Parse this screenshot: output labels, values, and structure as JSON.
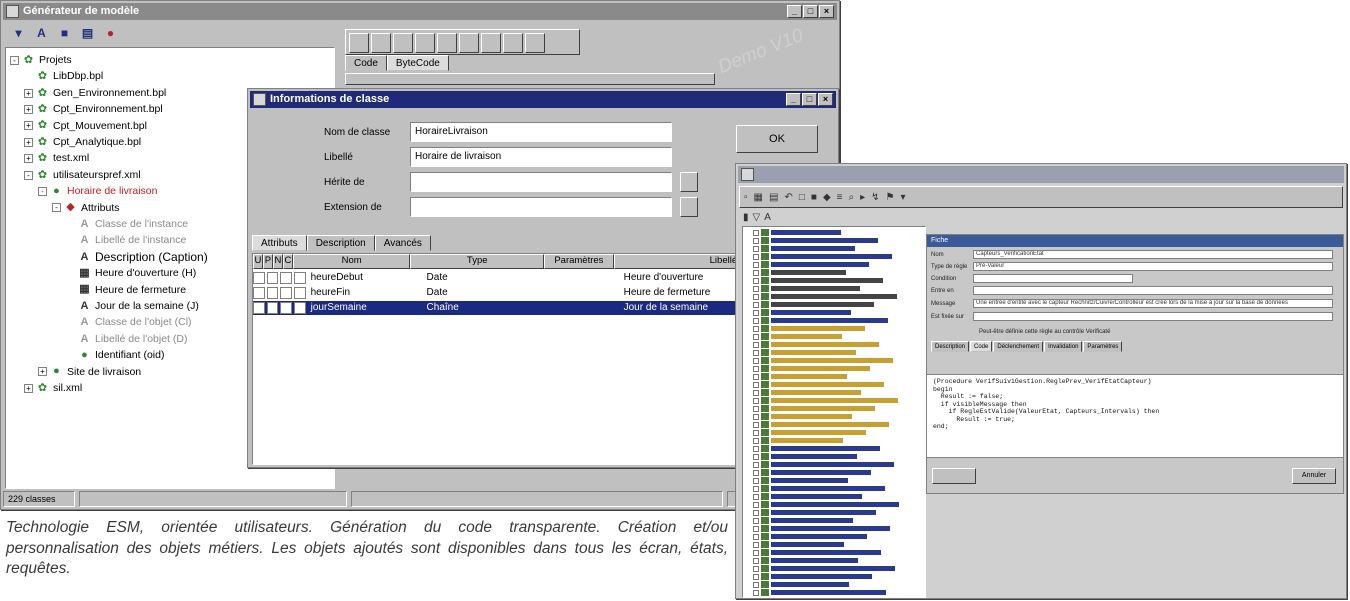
{
  "main_window": {
    "title": "Générateur de modèle",
    "status_left": "229 classes",
    "watermark": "Demo V10"
  },
  "tree": {
    "items": [
      {
        "label": "Projets",
        "depth": 0,
        "expander": "-",
        "icon": "project-icon",
        "style": ""
      },
      {
        "label": "LibDbp.bpl",
        "depth": 1,
        "expander": "",
        "icon": "package-icon",
        "style": ""
      },
      {
        "label": "Gen_Environnement.bpl",
        "depth": 1,
        "expander": "+",
        "icon": "package-icon",
        "style": ""
      },
      {
        "label": "Cpt_Environnement.bpl",
        "depth": 1,
        "expander": "+",
        "icon": "package-icon",
        "style": ""
      },
      {
        "label": "Cpt_Mouvement.bpl",
        "depth": 1,
        "expander": "+",
        "icon": "package-icon",
        "style": ""
      },
      {
        "label": "Cpt_Analytique.bpl",
        "depth": 1,
        "expander": "+",
        "icon": "package-icon",
        "style": ""
      },
      {
        "label": "test.xml",
        "depth": 1,
        "expander": "+",
        "icon": "package-icon",
        "style": ""
      },
      {
        "label": "utilisateurspref.xml",
        "depth": 1,
        "expander": "-",
        "icon": "package-icon",
        "style": ""
      },
      {
        "label": "Horaire de livraison",
        "depth": 2,
        "expander": "-",
        "icon": "class-icon",
        "style": "red"
      },
      {
        "label": "Attributs",
        "depth": 3,
        "expander": "-",
        "icon": "attributes-icon",
        "style": ""
      },
      {
        "label": "Classe de l'instance",
        "depth": 4,
        "expander": "",
        "icon": "attr-a-icon",
        "style": "grey"
      },
      {
        "label": "Libellé de l'instance",
        "depth": 4,
        "expander": "",
        "icon": "attr-a-icon",
        "style": "grey"
      },
      {
        "label": "Description (Caption)",
        "depth": 4,
        "expander": "",
        "icon": "attr-a-icon",
        "style": "big"
      },
      {
        "label": "Heure d'ouverture (H)",
        "depth": 4,
        "expander": "",
        "icon": "attr-time-icon",
        "style": ""
      },
      {
        "label": "Heure de fermeture",
        "depth": 4,
        "expander": "",
        "icon": "attr-time-icon",
        "style": ""
      },
      {
        "label": "Jour de la semaine (J)",
        "depth": 4,
        "expander": "",
        "icon": "attr-a-icon",
        "style": ""
      },
      {
        "label": "Classe de l'objet (Cl)",
        "depth": 4,
        "expander": "",
        "icon": "attr-a-icon",
        "style": "grey"
      },
      {
        "label": "Libellé de l'objet (D)",
        "depth": 4,
        "expander": "",
        "icon": "attr-a-icon",
        "style": "grey"
      },
      {
        "label": "Identifiant (oid)",
        "depth": 4,
        "expander": "",
        "icon": "id-icon",
        "style": ""
      },
      {
        "label": "Site de livraison",
        "depth": 2,
        "expander": "+",
        "icon": "class-icon",
        "style": ""
      },
      {
        "label": "sil.xml",
        "depth": 1,
        "expander": "+",
        "icon": "package-icon",
        "style": ""
      }
    ]
  },
  "right_tabs": [
    "Code",
    "ByteCode"
  ],
  "dialog": {
    "title": "Informations de classe",
    "fields": [
      {
        "label": "Nom de classe",
        "value": "HoraireLivraison"
      },
      {
        "label": "Libellé",
        "value": "Horaire de livraison"
      },
      {
        "label": "Hérite de",
        "value": ""
      },
      {
        "label": "Extension de",
        "value": ""
      }
    ],
    "ok_label": "OK",
    "tabs": [
      "Attributs",
      "Description",
      "Avancés"
    ],
    "columns": [
      "U",
      "P",
      "N",
      "C",
      "Nom",
      "Type",
      "Paramètres",
      "Libellé"
    ],
    "rows": [
      {
        "nom": "heureDebut",
        "type": "Date",
        "parametres": "",
        "libelle": "Heure d'ouverture",
        "selected": false
      },
      {
        "nom": "heureFin",
        "type": "Date",
        "parametres": "",
        "libelle": "Heure de fermeture",
        "selected": false
      },
      {
        "nom": "jourSemaine",
        "type": "Chaîne",
        "parametres": "",
        "libelle": "Jour de la semaine",
        "selected": true
      }
    ]
  },
  "editor": {
    "fiche_title": "Fiche",
    "fields": [
      {
        "label": "Nom",
        "value": "Capteurs_VerificationEtat"
      },
      {
        "label": "Type de règle",
        "value": "Pré-Valeur"
      },
      {
        "label": "Condition",
        "value": ""
      },
      {
        "label": "Entre en",
        "value": ""
      },
      {
        "label": "Message",
        "value": "Une entrée d'entité avec le capteur Rechnitz/Cuivre/Controlleur est créé lors de la mise à jour sur la base de données"
      },
      {
        "label": "Est fixée sur",
        "value": ""
      }
    ],
    "checkbox_label": "Peut-être définie cette règle au contrôle Verificaté",
    "tabs": [
      "Description",
      "Code",
      "Déclenchement",
      "Invalidation",
      "Paramètres"
    ],
    "code_lines": [
      "(Procedure VerifSuiviGestion.ReglePrev_VerifEtatCapteur)",
      "begin",
      "  Result := false;",
      "  if visibleMessage then",
      "    if RegleEstValide(ValeurEtat, Capteurs_Intervals) then",
      "      Result := true;",
      "end;"
    ],
    "cancel_label": "Annuler"
  },
  "caption": "Technologie ESM, orientée utilisateurs. Génération du code transparente. Création et/ou personnalisation des objets métiers. Les objets ajoutés sont disponibles dans tous les écran, états, requêtes."
}
